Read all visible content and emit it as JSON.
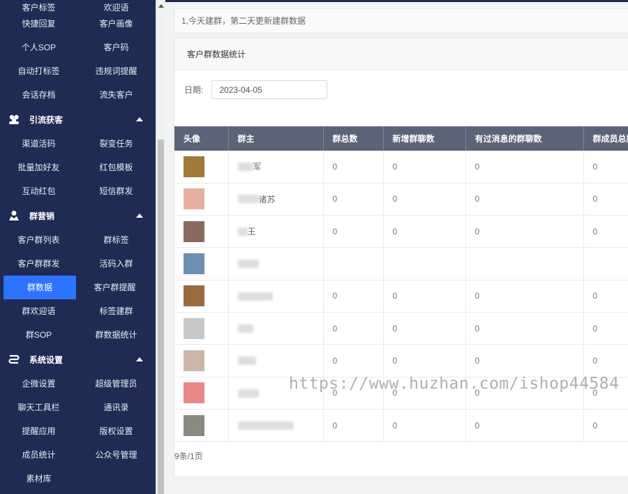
{
  "sidebar": {
    "partial_top": [
      "客户标签",
      "欢迎语"
    ],
    "group0_rows": [
      [
        "快捷回复",
        "客户画像"
      ],
      [
        "个人SOP",
        "客户码"
      ],
      [
        "自动打标签",
        "违规词提醒"
      ],
      [
        "会话存档",
        "流失客户"
      ]
    ],
    "sections": [
      {
        "label": "引流获客",
        "icon": "users-group-icon",
        "rows": [
          [
            "渠道活码",
            "裂变任务"
          ],
          [
            "批量加好友",
            "红包模板"
          ],
          [
            "互动红包",
            "短信群发"
          ]
        ]
      },
      {
        "label": "群营销",
        "icon": "user-icon",
        "rows": [
          [
            "客户群列表",
            "群标签"
          ],
          [
            "客户群群发",
            "活码入群"
          ],
          [
            "群数据",
            "客户群提醒"
          ],
          [
            "群欢迎语",
            "标签建群"
          ],
          [
            "群SOP",
            "群数据统计"
          ]
        ]
      },
      {
        "label": "系统设置",
        "icon": "settings-flow-icon",
        "rows": [
          [
            "企微设置",
            "超级管理员"
          ],
          [
            "聊天工具栏",
            "通讯录"
          ],
          [
            "提醒应用",
            "版权设置"
          ],
          [
            "成员统计",
            "公众号管理"
          ],
          [
            "素材库",
            ""
          ]
        ]
      }
    ],
    "active_item": "群数据"
  },
  "notice": "1,今天建群，第二天更新建群数据",
  "card": {
    "title": "客户群数据统计",
    "date_label": "日期:",
    "date_value": "2023-04-05"
  },
  "table": {
    "columns": [
      "头像",
      "群主",
      "群总数",
      "新增群聊数",
      "有过消息的群聊数",
      "群成员总数"
    ],
    "rows": [
      {
        "owner": "军",
        "total": "0",
        "new": "0",
        "msg": "0",
        "members": "0",
        "avatar_color": "#a07a3a"
      },
      {
        "owner": "诸苏",
        "total": "0",
        "new": "0",
        "msg": "0",
        "members": "0",
        "avatar_color": "#e6b0a0"
      },
      {
        "owner": "王",
        "total": "0",
        "new": "0",
        "msg": "0",
        "members": "0",
        "avatar_color": "#8a6a60"
      },
      {
        "owner": "",
        "total": "",
        "new": "",
        "msg": "",
        "members": "",
        "avatar_color": "#6f8fb0"
      },
      {
        "owner": "",
        "total": "0",
        "new": "0",
        "msg": "0",
        "members": "0",
        "avatar_color": "#9a6a40"
      },
      {
        "owner": "",
        "total": "0",
        "new": "0",
        "msg": "0",
        "members": "0",
        "avatar_color": "#c8c8c8"
      },
      {
        "owner": "",
        "total": "0",
        "new": "0",
        "msg": "0",
        "members": "0",
        "avatar_color": "#c9b8a8"
      },
      {
        "owner": "",
        "total": "0",
        "new": "0",
        "msg": "0",
        "members": "0",
        "avatar_color": "#e88888"
      },
      {
        "owner": "",
        "total": "0",
        "new": "0",
        "msg": "0",
        "members": "0",
        "avatar_color": "#8a8a80"
      }
    ]
  },
  "pager": "9条/1页",
  "watermark": "https://www.huzhan.com/ishop44584",
  "colors": {
    "sidebar_bg": "#1f2b53",
    "active_bg": "#2c73ff",
    "table_header_bg": "#5a6479"
  }
}
